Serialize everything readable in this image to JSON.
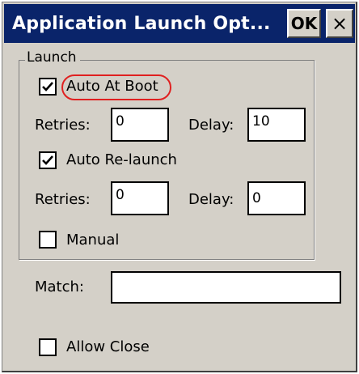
{
  "window": {
    "title": "Application Launch Opt...",
    "ok_label": "OK",
    "close_label": "×"
  },
  "launch_group": {
    "legend": "Launch",
    "auto_at_boot": {
      "label": "Auto At Boot",
      "checked": true
    },
    "boot_retries": {
      "label": "Retries:",
      "value": "0"
    },
    "boot_delay": {
      "label": "Delay:",
      "value": "10"
    },
    "auto_relaunch": {
      "label": "Auto Re-launch",
      "checked": true
    },
    "relaunch_retries": {
      "label": "Retries:",
      "value": "0"
    },
    "relaunch_delay": {
      "label": "Delay:",
      "value": "0"
    },
    "manual": {
      "label": "Manual",
      "checked": false
    }
  },
  "match": {
    "label": "Match:",
    "value": ""
  },
  "allow_close": {
    "label": "Allow Close",
    "checked": false
  },
  "colors": {
    "titlebar": "#0a246a",
    "face": "#d4d0c8",
    "highlight_circle": "#e02020"
  }
}
